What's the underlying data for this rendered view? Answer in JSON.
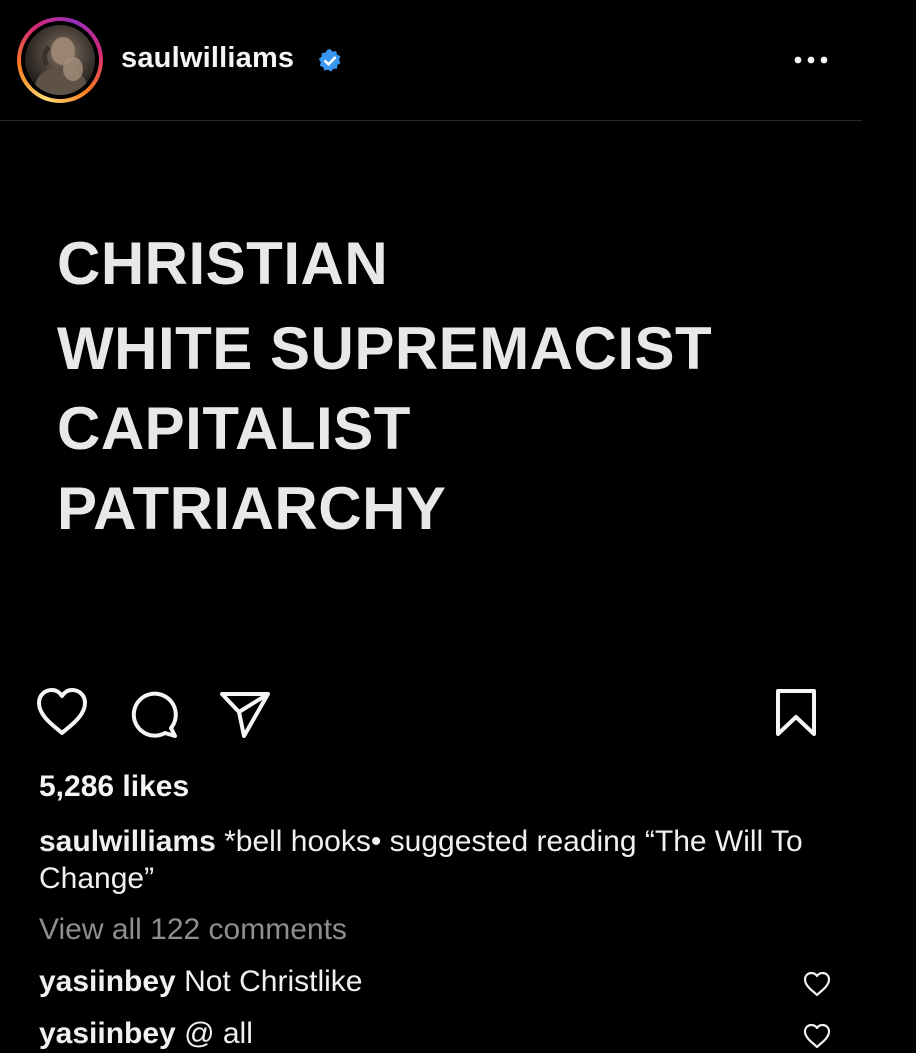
{
  "header": {
    "username": "saulwilliams",
    "verified_icon": "verified-badge-icon",
    "more_icon": "more-options-icon",
    "verified_color": "#3897f0"
  },
  "post": {
    "lines": [
      "CHRISTIAN",
      "WHITE SUPREMACIST",
      "CAPITALIST",
      "PATRIARCHY"
    ]
  },
  "actions": {
    "like_icon": "heart-icon",
    "comment_icon": "comment-icon",
    "share_icon": "paper-plane-icon",
    "save_icon": "bookmark-icon"
  },
  "likes": "5,286 likes",
  "caption": {
    "username": "saulwilliams",
    "text": " *bell hooks• suggested reading “The Will To Change”"
  },
  "view_all_comments": "View all 122 comments",
  "comments": [
    {
      "username": "yasiinbey",
      "text": " Not Christlike"
    },
    {
      "username": "yasiinbey",
      "text": " @ all"
    }
  ]
}
